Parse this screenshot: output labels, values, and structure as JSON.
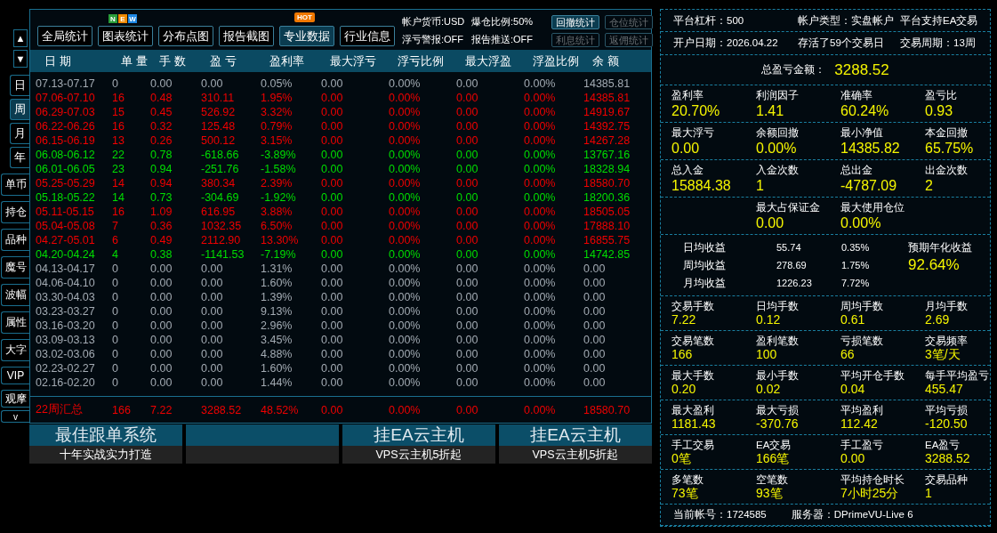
{
  "nav_arrows": [
    "▲",
    "▼"
  ],
  "period_tabs": [
    {
      "label": "日",
      "selected": false
    },
    {
      "label": "周",
      "selected": true
    },
    {
      "label": "月",
      "selected": false
    },
    {
      "label": "年",
      "selected": false
    }
  ],
  "view_tabs": [
    "单币",
    "持仓",
    "品种",
    "魔号",
    "波幅",
    "属性",
    "大字",
    "VIP",
    "观摩",
    "v"
  ],
  "toolbar": {
    "buttons": [
      {
        "label": "全局统计",
        "selected": false
      },
      {
        "label": "图表统计",
        "selected": false,
        "badge_letters": [
          {
            "text": "N",
            "color": "#2a9d3a"
          },
          {
            "text": "E",
            "color": "#f08a00"
          },
          {
            "text": "W",
            "color": "#1e88e5"
          }
        ]
      },
      {
        "label": "分布点图",
        "selected": false
      },
      {
        "label": "报告截图",
        "selected": false
      },
      {
        "label": "专业数据",
        "selected": true,
        "badge": "HOT"
      },
      {
        "label": "行业信息",
        "selected": false
      }
    ],
    "info": [
      "帐户货币:USD",
      "爆仓比例:50%",
      "浮亏警报:OFF",
      "报告推送:OFF"
    ],
    "small_buttons": [
      {
        "label": "回撤统计",
        "disabled": false
      },
      {
        "label": "仓位统计",
        "disabled": true
      },
      {
        "label": "利息统计",
        "disabled": true
      },
      {
        "label": "返佣统计",
        "disabled": true
      }
    ]
  },
  "table": {
    "columns": [
      "日 期",
      "单 量",
      "手 数",
      "盈 亏",
      "盈利率",
      "最大浮亏",
      "浮亏比例",
      "最大浮盈",
      "浮盈比例",
      "余 额"
    ],
    "rows": [
      {
        "color": "#a3abb3",
        "cells": [
          "07.13-07.17",
          "0",
          "0.00",
          "0.00",
          "0.05%",
          "0.00",
          "0.00%",
          "0.00",
          "0.00%",
          "14385.81"
        ]
      },
      {
        "color": "#f00000",
        "cells": [
          "07.06-07.10",
          "16",
          "0.48",
          "310.11",
          "1.95%",
          "0.00",
          "0.00%",
          "0.00",
          "0.00%",
          "14385.81"
        ]
      },
      {
        "color": "#f00000",
        "cells": [
          "06.29-07.03",
          "15",
          "0.45",
          "526.92",
          "3.32%",
          "0.00",
          "0.00%",
          "0.00",
          "0.00%",
          "14919.67"
        ]
      },
      {
        "color": "#f00000",
        "cells": [
          "06.22-06.26",
          "16",
          "0.32",
          "125.48",
          "0.79%",
          "0.00",
          "0.00%",
          "0.00",
          "0.00%",
          "14392.75"
        ]
      },
      {
        "color": "#f00000",
        "cells": [
          "06.15-06.19",
          "13",
          "0.26",
          "500.12",
          "3.15%",
          "0.00",
          "0.00%",
          "0.00",
          "0.00%",
          "14267.28"
        ]
      },
      {
        "color": "#00dd00",
        "cells": [
          "06.08-06.12",
          "22",
          "0.78",
          "-618.66",
          "-3.89%",
          "0.00",
          "0.00%",
          "0.00",
          "0.00%",
          "13767.16"
        ]
      },
      {
        "color": "#00dd00",
        "cells": [
          "06.01-06.05",
          "23",
          "0.94",
          "-251.76",
          "-1.58%",
          "0.00",
          "0.00%",
          "0.00",
          "0.00%",
          "18328.94"
        ]
      },
      {
        "color": "#f00000",
        "cells": [
          "05.25-05.29",
          "14",
          "0.94",
          "380.34",
          "2.39%",
          "0.00",
          "0.00%",
          "0.00",
          "0.00%",
          "18580.70"
        ]
      },
      {
        "color": "#00dd00",
        "cells": [
          "05.18-05.22",
          "14",
          "0.73",
          "-304.69",
          "-1.92%",
          "0.00",
          "0.00%",
          "0.00",
          "0.00%",
          "18200.36"
        ]
      },
      {
        "color": "#f00000",
        "cells": [
          "05.11-05.15",
          "16",
          "1.09",
          "616.95",
          "3.88%",
          "0.00",
          "0.00%",
          "0.00",
          "0.00%",
          "18505.05"
        ]
      },
      {
        "color": "#f00000",
        "cells": [
          "05.04-05.08",
          "7",
          "0.36",
          "1032.35",
          "6.50%",
          "0.00",
          "0.00%",
          "0.00",
          "0.00%",
          "17888.10"
        ]
      },
      {
        "color": "#f00000",
        "cells": [
          "04.27-05.01",
          "6",
          "0.49",
          "2112.90",
          "13.30%",
          "0.00",
          "0.00%",
          "0.00",
          "0.00%",
          "16855.75"
        ]
      },
      {
        "color": "#00dd00",
        "cells": [
          "04.20-04.24",
          "4",
          "0.38",
          "-1141.53",
          "-7.19%",
          "0.00",
          "0.00%",
          "0.00",
          "0.00%",
          "14742.85"
        ]
      },
      {
        "color": "#a3abb3",
        "cells": [
          "04.13-04.17",
          "0",
          "0.00",
          "0.00",
          "1.31%",
          "0.00",
          "0.00%",
          "0.00",
          "0.00%",
          "0.00"
        ]
      },
      {
        "color": "#a3abb3",
        "cells": [
          "04.06-04.10",
          "0",
          "0.00",
          "0.00",
          "1.60%",
          "0.00",
          "0.00%",
          "0.00",
          "0.00%",
          "0.00"
        ]
      },
      {
        "color": "#a3abb3",
        "cells": [
          "03.30-04.03",
          "0",
          "0.00",
          "0.00",
          "1.39%",
          "0.00",
          "0.00%",
          "0.00",
          "0.00%",
          "0.00"
        ]
      },
      {
        "color": "#a3abb3",
        "cells": [
          "03.23-03.27",
          "0",
          "0.00",
          "0.00",
          "9.13%",
          "0.00",
          "0.00%",
          "0.00",
          "0.00%",
          "0.00"
        ]
      },
      {
        "color": "#a3abb3",
        "cells": [
          "03.16-03.20",
          "0",
          "0.00",
          "0.00",
          "2.96%",
          "0.00",
          "0.00%",
          "0.00",
          "0.00%",
          "0.00"
        ]
      },
      {
        "color": "#a3abb3",
        "cells": [
          "03.09-03.13",
          "0",
          "0.00",
          "0.00",
          "3.45%",
          "0.00",
          "0.00%",
          "0.00",
          "0.00%",
          "0.00"
        ]
      },
      {
        "color": "#a3abb3",
        "cells": [
          "03.02-03.06",
          "0",
          "0.00",
          "0.00",
          "4.88%",
          "0.00",
          "0.00%",
          "0.00",
          "0.00%",
          "0.00"
        ]
      },
      {
        "color": "#a3abb3",
        "cells": [
          "02.23-02.27",
          "0",
          "0.00",
          "0.00",
          "1.60%",
          "0.00",
          "0.00%",
          "0.00",
          "0.00%",
          "0.00"
        ]
      },
      {
        "color": "#a3abb3",
        "cells": [
          "02.16-02.20",
          "0",
          "0.00",
          "0.00",
          "1.44%",
          "0.00",
          "0.00%",
          "0.00",
          "0.00%",
          "0.00"
        ]
      }
    ],
    "summary": {
      "color": "#f00000",
      "cells": [
        "22周汇总",
        "166",
        "7.22",
        "3288.52",
        "48.52%",
        "0.00",
        "0.00%",
        "0.00",
        "0.00%",
        "18580.70"
      ]
    }
  },
  "banners": [
    {
      "kind": "ad",
      "title": "最佳跟单系统",
      "subtitle": "十年实战实力打造"
    },
    {
      "kind": "blank"
    },
    {
      "kind": "ad",
      "title": "挂EA云主机",
      "subtitle": "VPS云主机5折起"
    },
    {
      "kind": "ad",
      "title": "挂EA云主机",
      "subtitle": "VPS云主机5折起"
    }
  ],
  "account": {
    "header_rows": [
      [
        "平台杠杆：500",
        "帐户类型：实盘帐户",
        "平台支持EA交易"
      ],
      [
        "开户日期：2026.04.22",
        "存活了59个交易日",
        "交易周期：13周"
      ]
    ],
    "total": {
      "label": "总盈亏金额：",
      "value": "3288.52"
    },
    "stat_groups_a": [
      {
        "kind": "grid",
        "items": [
          {
            "label": "盈利率",
            "value": "20.70%"
          },
          {
            "label": "利润因子",
            "value": "1.41"
          },
          {
            "label": "准确率",
            "value": "60.24%"
          },
          {
            "label": "盈亏比",
            "value": "0.93"
          }
        ]
      },
      {
        "kind": "grid",
        "items": [
          {
            "label": "最大浮亏",
            "value": "0.00"
          },
          {
            "label": "余额回撤",
            "value": "0.00%"
          },
          {
            "label": "最小净值",
            "value": "14385.82"
          },
          {
            "label": "本金回撤",
            "value": "65.75%"
          }
        ]
      },
      {
        "kind": "grid",
        "items": [
          {
            "label": "总入金",
            "value": "15884.38"
          },
          {
            "label": "入金次数",
            "value": "1"
          },
          {
            "label": "总出金",
            "value": "-4787.09"
          },
          {
            "label": "出金次数",
            "value": "2"
          }
        ]
      },
      {
        "kind": "pair",
        "items": [
          {
            "label": "最大占保证金",
            "value": "0.00"
          },
          {
            "label": "最大使用仓位",
            "value": "0.00%"
          }
        ]
      }
    ],
    "averages": {
      "rows": [
        {
          "label": "日均收益",
          "amount": "55.74",
          "percent": "0.35%"
        },
        {
          "label": "周均收益",
          "amount": "278.69",
          "percent": "1.75%"
        },
        {
          "label": "月均收益",
          "amount": "1226.23",
          "percent": "7.72%"
        }
      ],
      "annual": {
        "label": "预期年化收益",
        "value": "92.64%"
      }
    },
    "stat_groups_b": [
      {
        "kind": "grid",
        "items": [
          {
            "label": "交易手数",
            "value": "7.22"
          },
          {
            "label": "日均手数",
            "value": "0.12"
          },
          {
            "label": "周均手数",
            "value": "0.61"
          },
          {
            "label": "月均手数",
            "value": "2.69"
          }
        ]
      },
      {
        "kind": "grid",
        "items": [
          {
            "label": "交易笔数",
            "value": "166"
          },
          {
            "label": "盈利笔数",
            "value": "100"
          },
          {
            "label": "亏损笔数",
            "value": "66"
          },
          {
            "label": "交易频率",
            "value": "3笔/天"
          }
        ]
      },
      {
        "kind": "grid",
        "items": [
          {
            "label": "最大手数",
            "value": "0.20"
          },
          {
            "label": "最小手数",
            "value": "0.02"
          },
          {
            "label": "平均开仓手数",
            "value": "0.04"
          },
          {
            "label": "每手平均盈亏",
            "value": "455.47"
          }
        ]
      },
      {
        "kind": "grid",
        "items": [
          {
            "label": "最大盈利",
            "value": "1181.43"
          },
          {
            "label": "最大亏损",
            "value": "-370.76"
          },
          {
            "label": "平均盈利",
            "value": "112.42"
          },
          {
            "label": "平均亏损",
            "value": "-120.50"
          }
        ]
      },
      {
        "kind": "grid",
        "items": [
          {
            "label": "手工交易",
            "value": "0笔"
          },
          {
            "label": "EA交易",
            "value": "166笔"
          },
          {
            "label": "手工盈亏",
            "value": "0.00"
          },
          {
            "label": "EA盈亏",
            "value": "3288.52"
          }
        ]
      },
      {
        "kind": "grid",
        "items": [
          {
            "label": "多笔数",
            "value": "73笔"
          },
          {
            "label": "空笔数",
            "value": "93笔"
          },
          {
            "label": "平均持仓时长",
            "value": "7小时25分"
          },
          {
            "label": "交易品种",
            "value": "1"
          }
        ]
      }
    ],
    "footer": [
      "当前帐号：1724585",
      "服务器：DPrimeVU-Live 6"
    ]
  }
}
